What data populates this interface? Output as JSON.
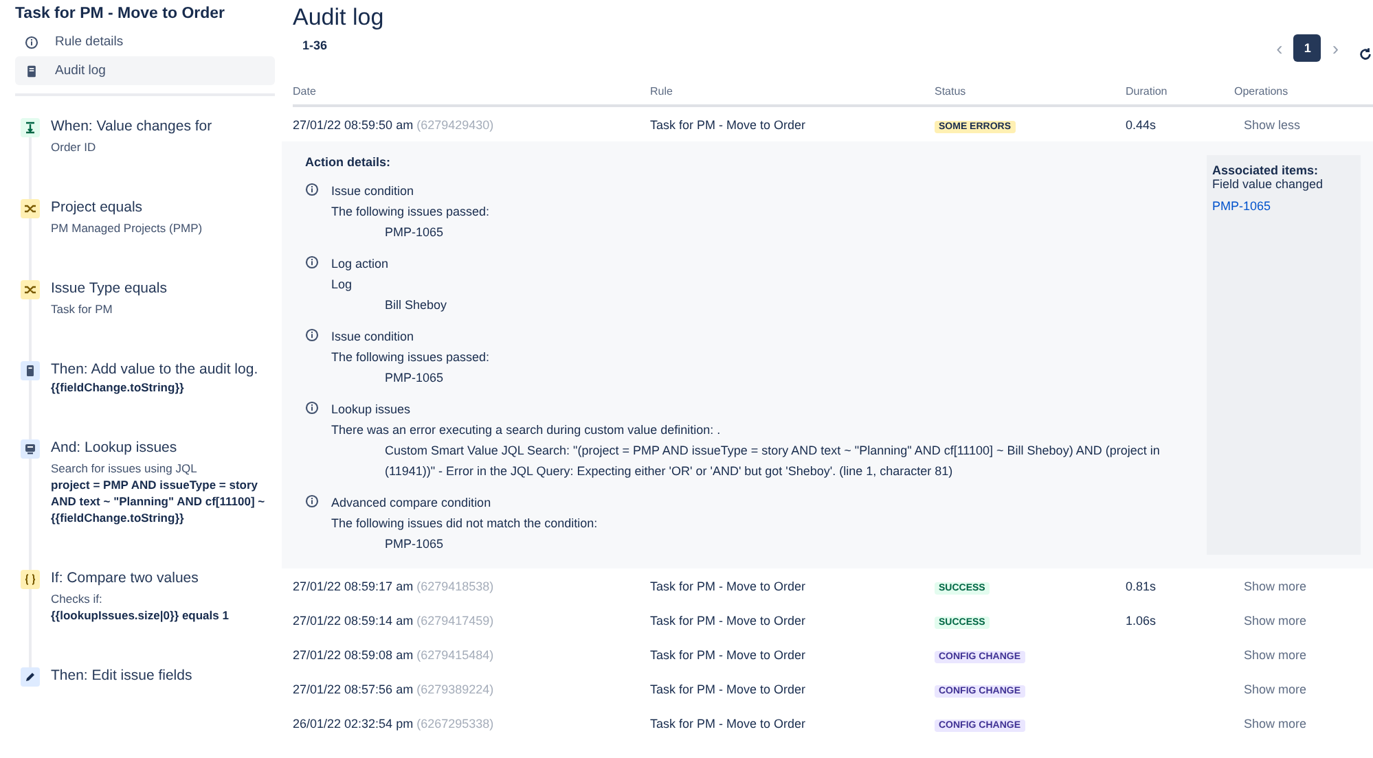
{
  "sidebar": {
    "title": "Task for PM - Move to Order",
    "nav": [
      {
        "label": "Rule details",
        "kind": "info",
        "selected": false
      },
      {
        "label": "Audit log",
        "kind": "log",
        "selected": true
      }
    ],
    "steps": [
      {
        "kind": "trigger",
        "title": "When: Value changes for",
        "lines": [
          {
            "kind": "plain",
            "text": "Order ID"
          }
        ]
      },
      {
        "kind": "condition",
        "title": "Project equals",
        "lines": [
          {
            "kind": "plain",
            "text": "PM Managed Projects (PMP)"
          }
        ]
      },
      {
        "kind": "condition",
        "title": "Issue Type equals",
        "lines": [
          {
            "kind": "plain",
            "text": "Task for PM"
          }
        ]
      },
      {
        "kind": "log",
        "title": "Then: Add value to the audit log.",
        "lines": [
          {
            "kind": "code",
            "text": "{{fieldChange.toString}}"
          }
        ]
      },
      {
        "kind": "lookup",
        "title": "And: Lookup issues",
        "lines": [
          {
            "kind": "plain",
            "text": "Search for issues using JQL"
          },
          {
            "kind": "code",
            "text": "project = PMP AND issueType = story AND text ~ \"Planning\" AND cf[11100] ~ {{fieldChange.toString}}"
          }
        ]
      },
      {
        "kind": "compare",
        "title": "If: Compare two values",
        "lines": [
          {
            "kind": "plain",
            "text": "Checks if:"
          },
          {
            "kind": "code",
            "text": "{{lookupIssues.size|0}} equals 1"
          }
        ]
      },
      {
        "kind": "edit",
        "title": "Then: Edit issue fields"
      }
    ]
  },
  "main": {
    "title": "Audit log",
    "range": "1-36",
    "pagination": {
      "prev": "‹",
      "pages": [
        {
          "label": "1",
          "selected": true
        }
      ],
      "next": "›"
    },
    "columns": [
      "Date",
      "Rule",
      "Status",
      "Duration",
      "Operations"
    ],
    "rows": [
      {
        "date": "27/01/22 08:59:50 am",
        "id": "(6279429430)",
        "rule": "Task for PM - Move to Order",
        "status": {
          "label": "SOME ERRORS",
          "kind": "warning"
        },
        "duration": "0.44s",
        "operation": "Show less",
        "details": {
          "heading": "Action details:",
          "entries": [
            {
              "title": "Issue condition",
              "message": "The following issues passed:",
              "items": [
                "PMP-1065"
              ]
            },
            {
              "title": "Log action",
              "message": "Log",
              "items": [
                "Bill Sheboy"
              ]
            },
            {
              "title": "Issue condition",
              "message": "The following issues passed:",
              "items": [
                "PMP-1065"
              ]
            },
            {
              "title": "Lookup issues",
              "message": "There was an error executing a search during custom value definition: .",
              "items": [
                "Custom Smart Value JQL Search: \"(project = PMP AND issueType = story AND text ~ \"Planning\" AND cf[11100] ~ Bill Sheboy) AND (project in (11941))\" - Error in the JQL Query: Expecting either 'OR' or 'AND' but got 'Sheboy'. (line 1, character 81)"
              ]
            },
            {
              "title": "Advanced compare condition",
              "message": "The following issues did not match the condition:",
              "items": [
                "PMP-1065"
              ]
            }
          ],
          "associated": {
            "heading": "Associated items:",
            "subheading": "Field value changed",
            "links": [
              "PMP-1065"
            ]
          }
        }
      },
      {
        "date": "27/01/22 08:59:17 am",
        "id": "(6279418538)",
        "rule": "Task for PM - Move to Order",
        "status": {
          "label": "SUCCESS",
          "kind": "success"
        },
        "duration": "0.81s",
        "operation": "Show more"
      },
      {
        "date": "27/01/22 08:59:14 am",
        "id": "(6279417459)",
        "rule": "Task for PM - Move to Order",
        "status": {
          "label": "SUCCESS",
          "kind": "success"
        },
        "duration": "1.06s",
        "operation": "Show more"
      },
      {
        "date": "27/01/22 08:59:08 am",
        "id": "(6279415484)",
        "rule": "Task for PM - Move to Order",
        "status": {
          "label": "CONFIG CHANGE",
          "kind": "config"
        },
        "operation": "Show more"
      },
      {
        "date": "27/01/22 08:57:56 am",
        "id": "(6279389224)",
        "rule": "Task for PM - Move to Order",
        "status": {
          "label": "CONFIG CHANGE",
          "kind": "config"
        },
        "operation": "Show more"
      },
      {
        "date": "26/01/22 02:32:54 pm",
        "id": "(6267295338)",
        "rule": "Task for PM - Move to Order",
        "status": {
          "label": "CONFIG CHANGE",
          "kind": "config"
        },
        "operation": "Show more"
      }
    ]
  }
}
